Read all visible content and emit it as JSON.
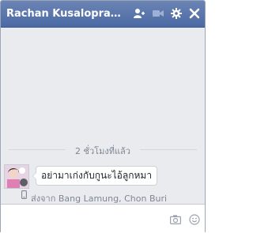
{
  "header": {
    "title": "Rachan Kusaloprasert"
  },
  "messages": {
    "timestamp": "2 ชั่วโมงที่แล้ว",
    "text": "อย่ามาเก่งกับกูนะไอ้ลูกหมา",
    "location": "ส่งจาก Bang Lamung, Chon Buri"
  },
  "composer": {
    "placeholder": ""
  },
  "colors": {
    "header": "#4e69a2",
    "panel": "#e9ebee",
    "bubble_border": "#cdd1d8"
  }
}
